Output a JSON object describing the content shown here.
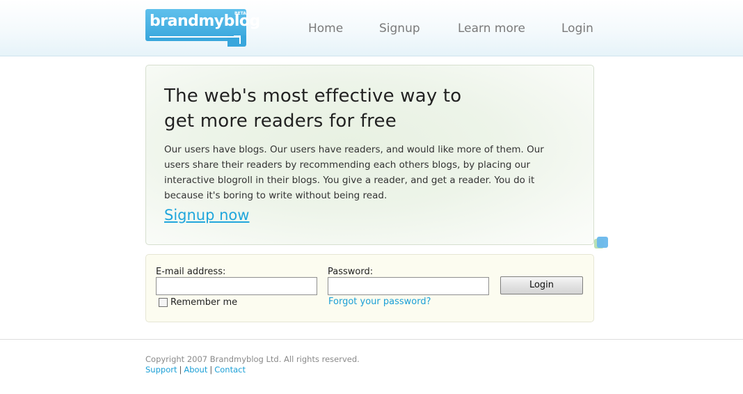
{
  "header": {
    "logo_text": "brandmyblog",
    "logo_badge": "BETA",
    "nav": [
      {
        "label": "Home"
      },
      {
        "label": "Signup"
      },
      {
        "label": "Learn more"
      },
      {
        "label": "Login"
      }
    ]
  },
  "hero": {
    "title_line1": "The web's most effective way to",
    "title_line2": "get more readers for free",
    "body": "Our users have blogs. Our users have readers, and would like more of them. Our users share their readers by recommending each others blogs, by placing our interactive blogroll in their blogs. You give a reader, and get a reader. You do it because it's boring to write without being read.",
    "signup_link": "Signup now"
  },
  "login": {
    "email_label": "E-mail address:",
    "email_value": "",
    "password_label": "Password:",
    "password_value": "",
    "remember_label": "Remember me",
    "remember_checked": false,
    "forgot_link": "Forgot your password?",
    "button_label": "Login"
  },
  "footer": {
    "copyright": "Copyright 2007 Brandmyblog Ltd. All rights reserved.",
    "links": [
      {
        "label": "Support"
      },
      {
        "label": "About"
      },
      {
        "label": "Contact"
      }
    ],
    "separator": "|"
  },
  "colors": {
    "accent": "#21a6dc",
    "logo_blue": "#38a6dc",
    "nav_text": "#7a7a7a"
  }
}
